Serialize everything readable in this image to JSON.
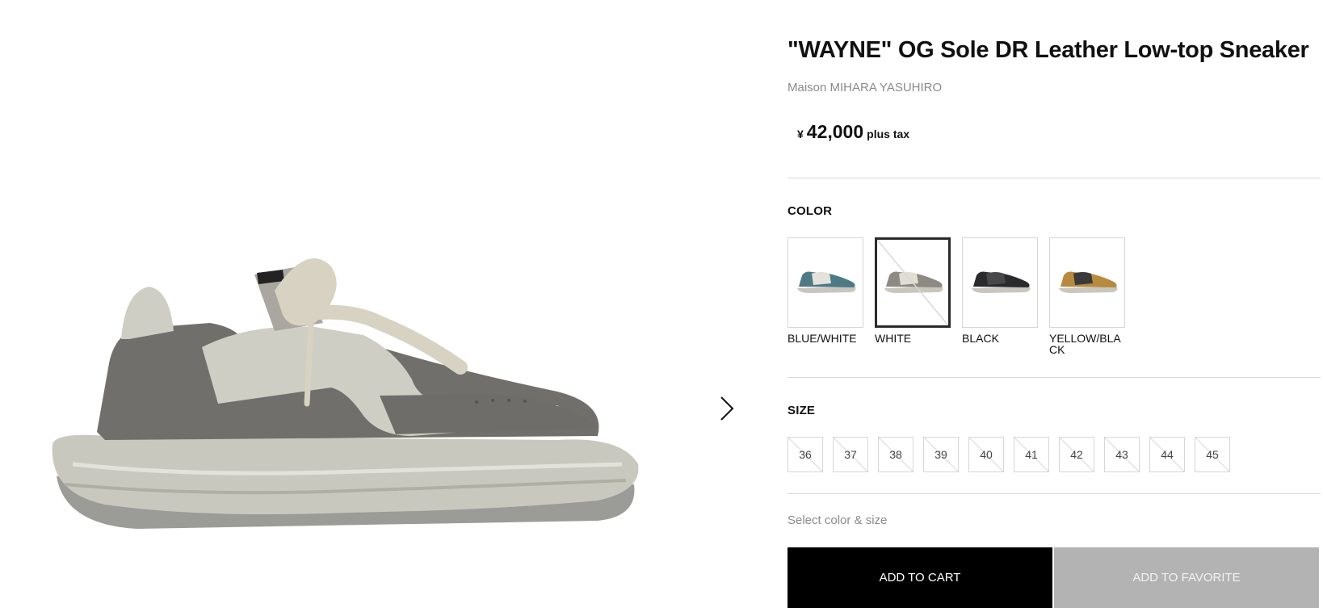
{
  "product": {
    "title": "\"WAYNE\" OG Sole DR Leather Low-top Sneaker",
    "brand": "Maison MIHARA YASUHIRO",
    "price": {
      "currency": "¥",
      "amount": "42,000",
      "tax_note": "plus tax"
    },
    "image_icon": "sneaker-photo"
  },
  "gallery": {
    "next_icon": "chevron-right-icon"
  },
  "color_section": {
    "label": "COLOR",
    "selected": "WHITE",
    "options": [
      {
        "name": "BLUE/WHITE",
        "accent": "#4e7a86",
        "available": true
      },
      {
        "name": "WHITE",
        "accent": "#8c8a82",
        "available": false
      },
      {
        "name": "BLACK",
        "accent": "#2a2a2c",
        "available": true
      },
      {
        "name": "YELLOW/BLACK",
        "accent": "#b88a3e",
        "available": true
      }
    ]
  },
  "size_section": {
    "label": "SIZE",
    "options": [
      "36",
      "37",
      "38",
      "39",
      "40",
      "41",
      "42",
      "43",
      "44",
      "45"
    ]
  },
  "hint": "Select color & size",
  "actions": {
    "add_to_cart": "ADD TO CART",
    "add_to_favorite": "ADD TO FAVORITE"
  },
  "colors": {
    "primary_button": "#000000",
    "disabled_button": "#b3b3b3",
    "muted_text": "#8a8a8a"
  }
}
